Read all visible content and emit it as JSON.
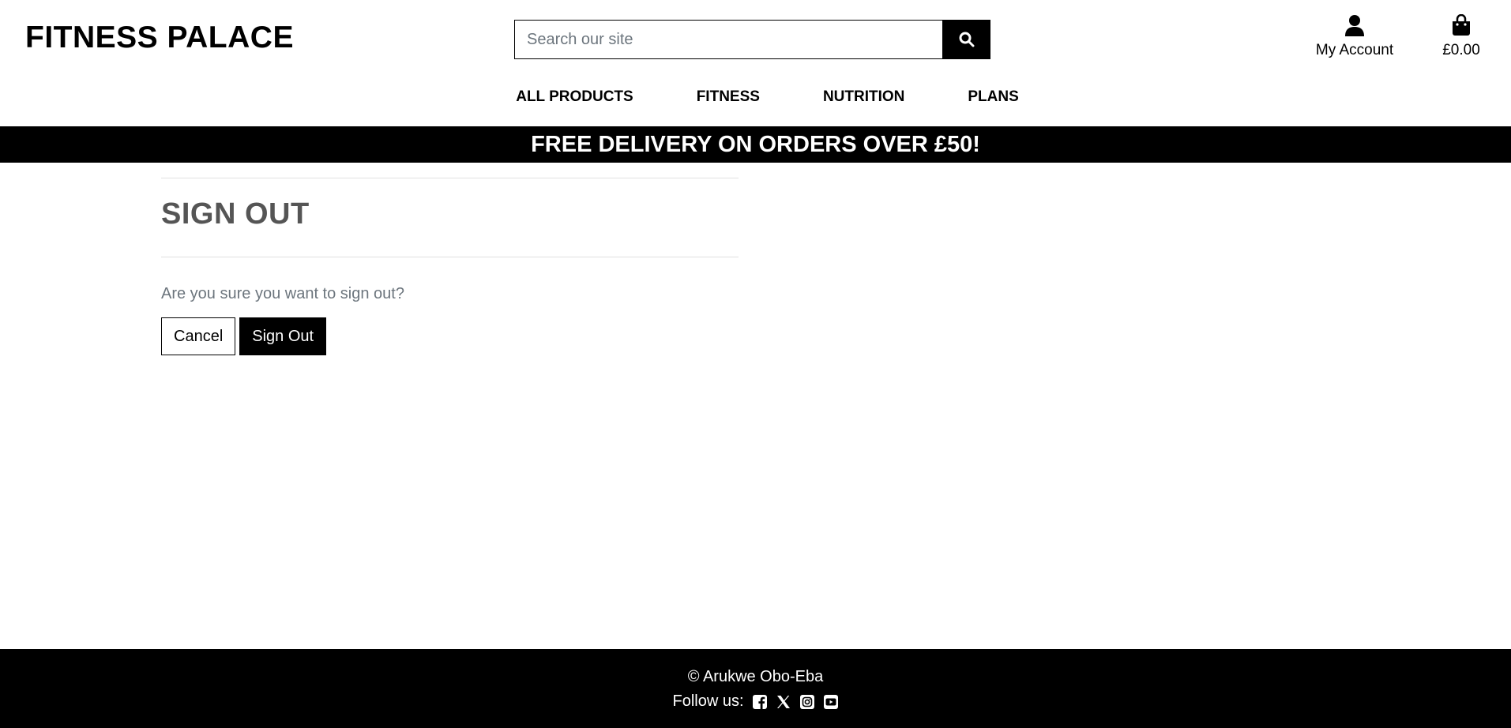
{
  "header": {
    "logo": "FITNESS PALACE",
    "search": {
      "placeholder": "Search our site",
      "value": ""
    },
    "account_label": "My Account",
    "bag_total": "£0.00"
  },
  "nav": {
    "items": [
      {
        "label": "ALL PRODUCTS"
      },
      {
        "label": "FITNESS"
      },
      {
        "label": "NUTRITION"
      },
      {
        "label": "PLANS"
      }
    ]
  },
  "banner": {
    "text": "FREE DELIVERY ON ORDERS OVER £50!"
  },
  "main": {
    "title": "SIGN OUT",
    "question": "Are you sure you want to sign out?",
    "cancel_label": "Cancel",
    "signout_label": "Sign Out"
  },
  "footer": {
    "copyright": "© Arukwe Obo-Eba",
    "follow_label": "Follow us:",
    "social_icons": [
      "facebook-icon",
      "x-twitter-icon",
      "instagram-icon",
      "youtube-icon"
    ]
  },
  "colors": {
    "primary": "#000000",
    "background": "#ffffff",
    "muted_text": "#6c757d",
    "title_text": "#555555"
  }
}
